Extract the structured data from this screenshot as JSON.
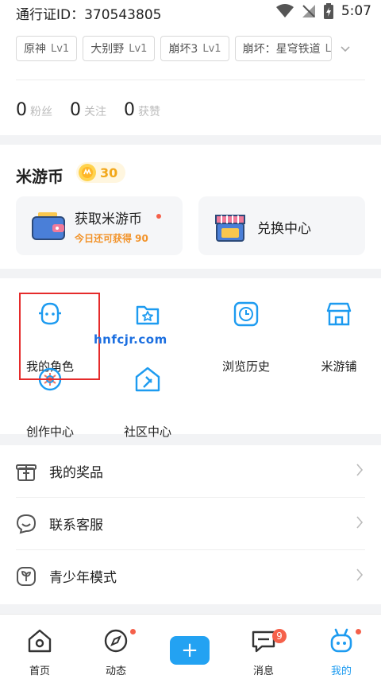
{
  "status_bar": {
    "pass_id": "通行证ID：370543805",
    "time": "5:07"
  },
  "game_tags": [
    {
      "name": "原神",
      "level": "Lv1"
    },
    {
      "name": "大别野",
      "level": "Lv1"
    },
    {
      "name": "崩坏3",
      "level": "Lv1"
    },
    {
      "name": "崩坏：星穹铁道",
      "level": "L"
    }
  ],
  "stats": [
    {
      "value": "0",
      "label": "粉丝"
    },
    {
      "value": "0",
      "label": "关注"
    },
    {
      "value": "0",
      "label": "获赞"
    }
  ],
  "coins": {
    "title": "米游币",
    "balance": "30",
    "earn_card": {
      "title": "获取米游币",
      "subtitle": "今日还可获得 90"
    },
    "exchange_card": {
      "title": "兑换中心"
    }
  },
  "grid": {
    "items": [
      {
        "label": "我的角色",
        "icon": "character-icon"
      },
      {
        "label": "",
        "icon": "favorites-icon"
      },
      {
        "label": "浏览历史",
        "icon": "history-icon"
      },
      {
        "label": "米游铺",
        "icon": "shop-icon"
      },
      {
        "label": "创作中心",
        "icon": "creation-icon"
      },
      {
        "label": "社区中心",
        "icon": "community-icon"
      }
    ]
  },
  "watermark": "hnfcjr.com",
  "list": [
    {
      "label": "我的奖品",
      "icon": "gift-icon"
    },
    {
      "label": "联系客服",
      "icon": "service-icon"
    },
    {
      "label": "青少年模式",
      "icon": "youth-icon"
    }
  ],
  "tabbar": {
    "tabs": [
      {
        "label": "首页",
        "icon": "home-icon"
      },
      {
        "label": "动态",
        "icon": "compass-icon"
      },
      {
        "label": "消息",
        "icon": "message-icon",
        "badge": "9"
      },
      {
        "label": "我的",
        "icon": "profile-icon"
      }
    ],
    "plus_symbol": "+"
  },
  "colors": {
    "accent": "#23a2f2",
    "coin": "#f2a71a",
    "alert": "#f5604a"
  }
}
